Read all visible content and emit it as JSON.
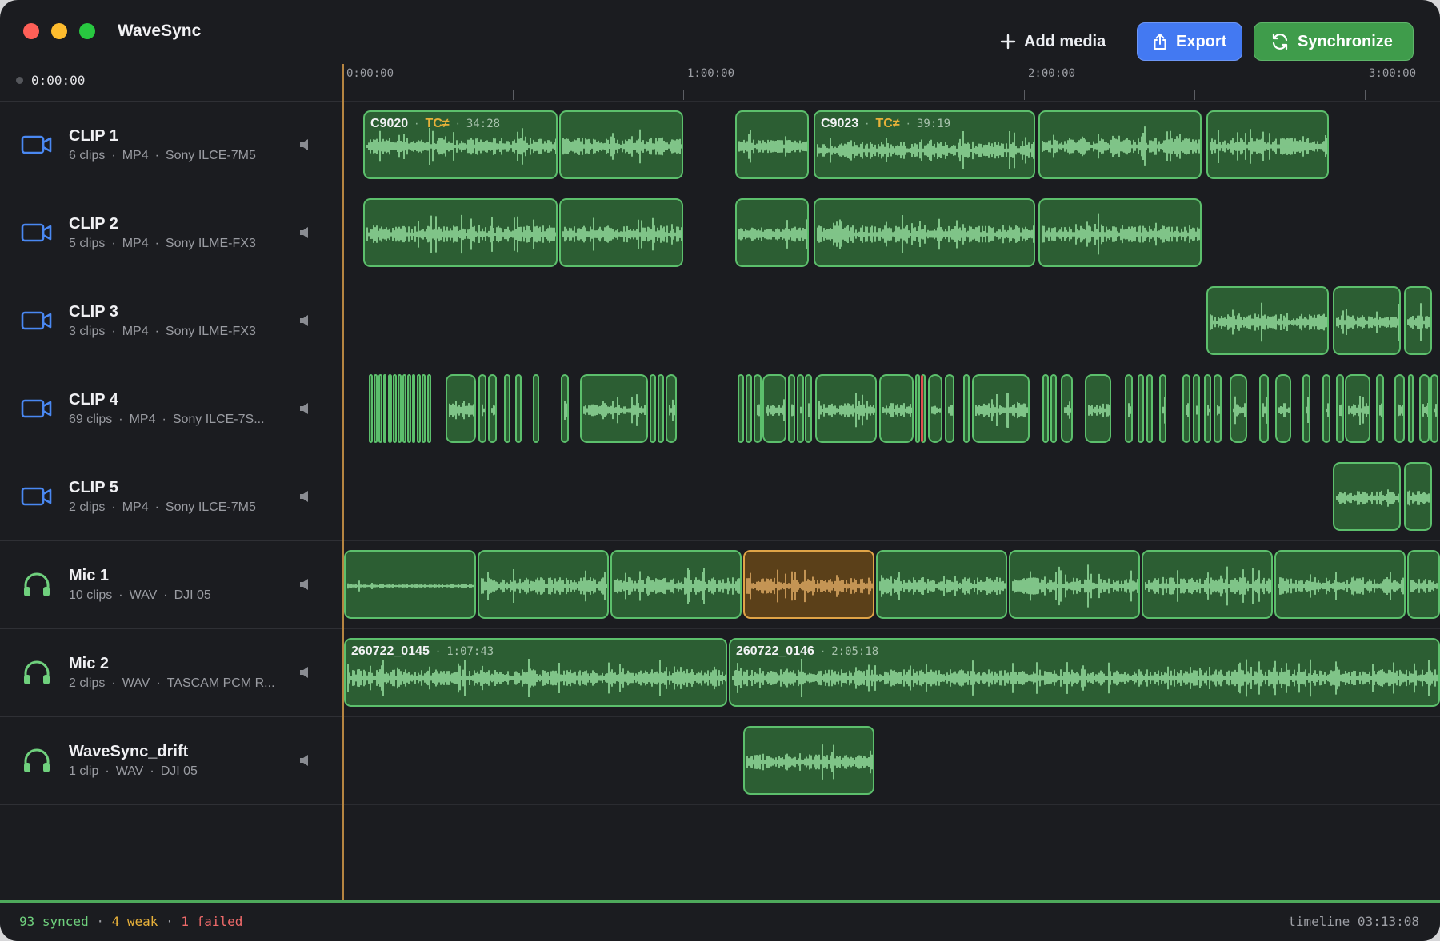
{
  "window": {
    "title": "WaveSync",
    "traffic_colors": [
      "#fe5f57",
      "#febc2e",
      "#28c840"
    ]
  },
  "toolbar": {
    "add_media_label": "Add media",
    "export_label": "Export",
    "synchronize_label": "Synchronize"
  },
  "playhead_timecode": "0:00:00",
  "ruler": {
    "labels": [
      "0:00:00",
      "1:00:00",
      "2:00:00",
      "3:00:00"
    ]
  },
  "tracks": [
    {
      "name": "CLIP 1",
      "icon": "video-camera-icon",
      "clips": "6 clips",
      "format": "MP4",
      "device": "Sony ILCE-7M5"
    },
    {
      "name": "CLIP 2",
      "icon": "video-camera-icon",
      "clips": "5 clips",
      "format": "MP4",
      "device": "Sony ILME-FX3"
    },
    {
      "name": "CLIP 3",
      "icon": "video-camera-icon",
      "clips": "3 clips",
      "format": "MP4",
      "device": "Sony ILME-FX3"
    },
    {
      "name": "CLIP 4",
      "icon": "video-camera-icon",
      "clips": "69 clips",
      "format": "MP4",
      "device": "Sony ILCE-7S..."
    },
    {
      "name": "CLIP 5",
      "icon": "video-camera-icon",
      "clips": "2 clips",
      "format": "MP4",
      "device": "Sony ILCE-7M5"
    },
    {
      "name": "Mic 1",
      "icon": "headphones-icon",
      "clips": "10 clips",
      "format": "WAV",
      "device": "DJI 05"
    },
    {
      "name": "Mic 2",
      "icon": "headphones-icon",
      "clips": "2 clips",
      "format": "WAV",
      "device": "TASCAM PCM R..."
    },
    {
      "name": "WaveSync_drift",
      "icon": "headphones-icon",
      "clips": "1 clip",
      "format": "WAV",
      "device": "DJI 05"
    }
  ],
  "clip_labels": [
    {
      "name": "C9020",
      "tc": "TC≠",
      "duration": "34:28"
    },
    {
      "name": "C9023",
      "tc": "TC≠",
      "duration": "39:19"
    },
    {
      "name": "260722_0145",
      "duration": "1:07:43"
    },
    {
      "name": "260722_0146",
      "duration": "2:05:18"
    }
  ],
  "status": {
    "synced": "93 synced",
    "weak": "4 weak",
    "failed": "1 failed",
    "separator": "·",
    "timeline": "timeline 03:13:08",
    "colors": {
      "synced": "#6fd07d",
      "weak": "#e8b13a",
      "failed": "#ef6a6a"
    }
  },
  "colors": {
    "clip_fill": "#2c5e33",
    "clip_border": "#5cbf6c",
    "waveform": "#9be6a4",
    "clip_warning": "#e0a447",
    "export_button": "#4379f2",
    "synchronize_button": "#3f9c4b",
    "video_icon": "#4a88f2",
    "audio_icon": "#6fd07d"
  }
}
